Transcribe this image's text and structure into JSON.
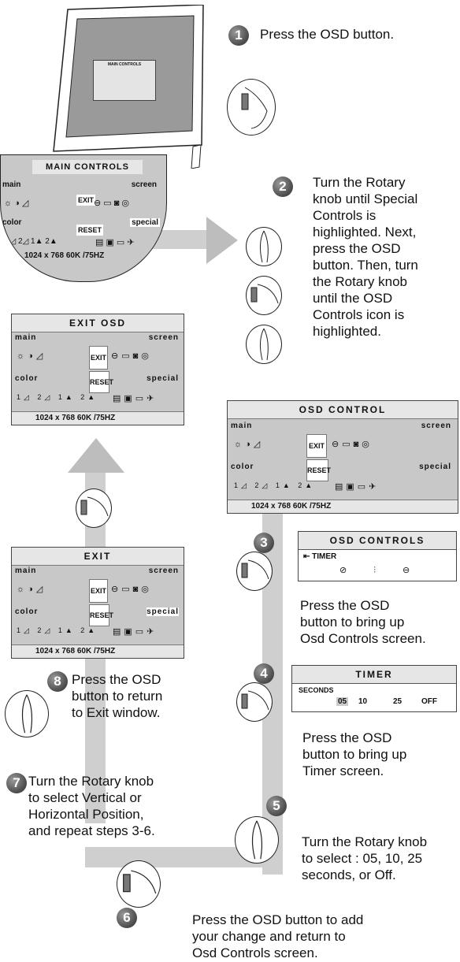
{
  "steps": {
    "s1": {
      "num": "1",
      "text": "Press the OSD button."
    },
    "s2": {
      "num": "2",
      "lines": [
        "Turn the Rotary",
        "knob until Special",
        "Controls is",
        "highlighted. Next,",
        "press the OSD",
        "button. Then, turn",
        "the Rotary knob",
        "until the OSD",
        "Controls icon is",
        "highlighted."
      ]
    },
    "s3": {
      "num": "3",
      "lines": [
        "Press the OSD",
        "button to bring up",
        "Osd Controls screen."
      ]
    },
    "s4": {
      "num": "4",
      "lines": [
        "Press the OSD",
        "button to bring up",
        "Timer screen."
      ]
    },
    "s5": {
      "num": "5",
      "lines": [
        "Turn the Rotary knob",
        "to select : 05, 10, 25",
        "seconds, or Off."
      ]
    },
    "s6": {
      "num": "6",
      "lines": [
        "Press the OSD button to add",
        "your change and return to",
        "Osd Controls screen."
      ]
    },
    "s7": {
      "num": "7",
      "lines": [
        "Turn the Rotary knob",
        "to select Vertical or",
        "Horizontal Position,",
        "and repeat steps 3-6."
      ]
    },
    "s8": {
      "num": "8",
      "lines": [
        "Press the OSD",
        "button to return",
        "to Exit window."
      ]
    }
  },
  "monitor": {
    "screen_title": "MAIN CONTROLS"
  },
  "panels": {
    "main_controls": {
      "title": "MAIN CONTROLS",
      "main": "main",
      "screen": "screen",
      "color": "color",
      "special": "special",
      "exit": "EXIT",
      "reset": "RESET",
      "footer": "1024 x 768    60K /75HZ"
    },
    "exit_osd": {
      "title": "EXIT OSD",
      "main": "main",
      "screen": "screen",
      "color": "color",
      "special": "special",
      "exit": "EXIT",
      "reset": "RESET",
      "footer": "1024 x 768    60K /75HZ"
    },
    "osd_control": {
      "title": "OSD  CONTROL",
      "main": "main",
      "screen": "screen",
      "color": "color",
      "special": "special",
      "exit": "EXIT",
      "reset": "RESET",
      "footer": "1024 x 768    60K /75HZ"
    },
    "exit": {
      "title": "EXIT",
      "main": "main",
      "screen": "screen",
      "color": "color",
      "special": "special",
      "exit": "EXIT",
      "reset": "RESET",
      "footer": "1024 x 768    60K /75HZ"
    }
  },
  "osd_controls_screen": {
    "title": "OSD  CONTROLS",
    "item": "TIMER"
  },
  "timer_screen": {
    "title": "TIMER",
    "label": "SECONDS",
    "options": [
      "05",
      "10",
      "25",
      "OFF"
    ]
  },
  "colors": {
    "track": "#c8c8c8",
    "badge": "#5a5a5a",
    "panel": "#c8c8c8"
  }
}
